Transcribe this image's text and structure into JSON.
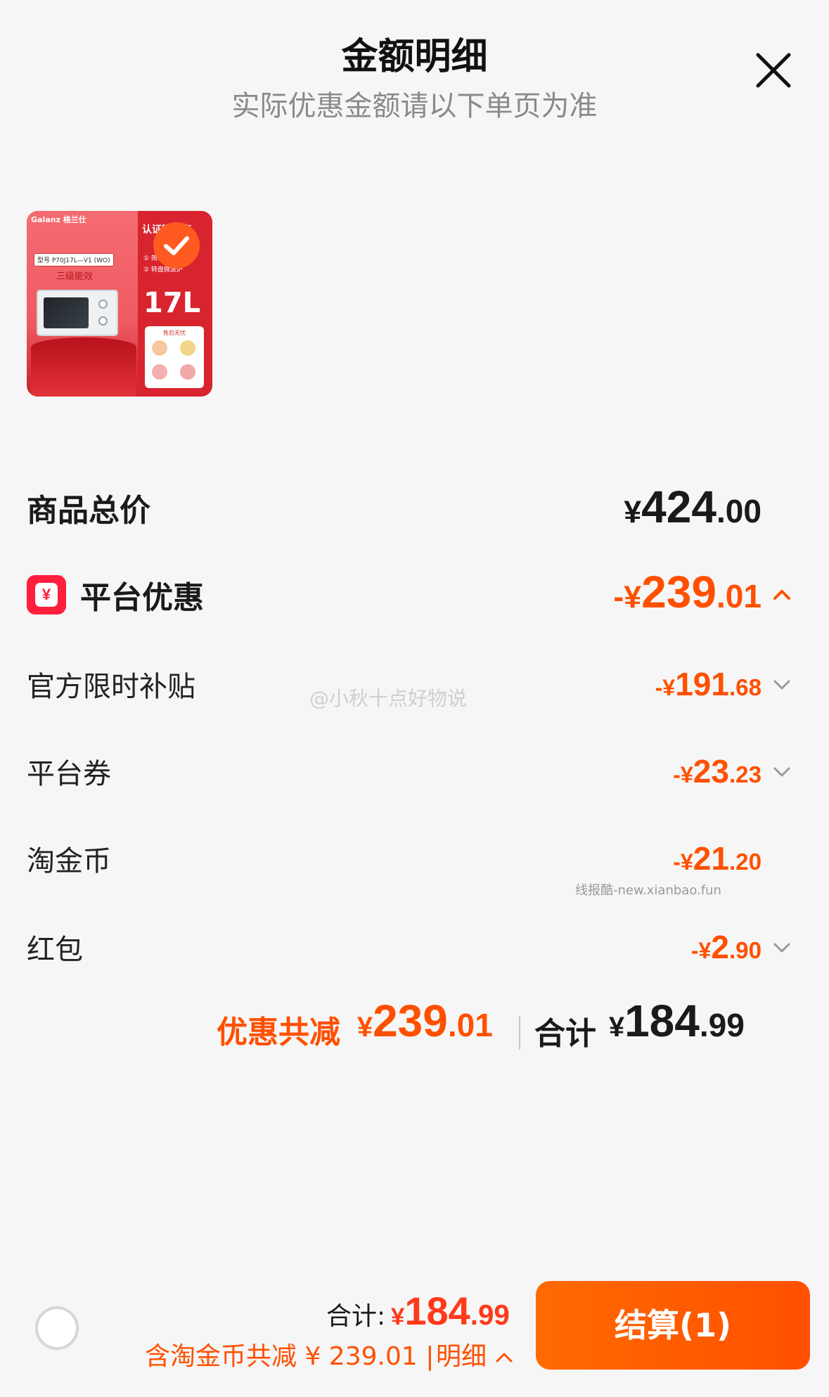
{
  "header": {
    "title": "金额明细",
    "subtitle": "实际优惠金额请以下单页为准",
    "close_icon": "close-icon"
  },
  "product": {
    "brand": "Galanz 格兰仕",
    "model": "型号 P70J17L—V1 (WO)",
    "energy": "三级能效",
    "certified": "认证旗舰店",
    "features": [
      "① 简单易用",
      "② 转盘微波炉"
    ],
    "capacity": "17L",
    "after_sales": "售后无忧",
    "selected": true
  },
  "price_rows": {
    "total": {
      "label": "商品总价",
      "sign": "¥",
      "integer": "424",
      "decimal": ".00"
    },
    "platform": {
      "label": "平台优惠",
      "sign": "-¥",
      "integer": "239",
      "decimal": ".01",
      "icon": "coupon-icon",
      "expanded": true
    },
    "items": [
      {
        "label": "官方限时补贴",
        "sign": "-¥",
        "integer": "191",
        "decimal": ".68",
        "chevron": true
      },
      {
        "label": "平台券",
        "sign": "-¥",
        "integer": "23",
        "decimal": ".23",
        "chevron": true
      },
      {
        "label": "淘金币",
        "sign": "-¥",
        "integer": "21",
        "decimal": ".20",
        "chevron": false
      },
      {
        "label": "红包",
        "sign": "-¥",
        "integer": "2",
        "decimal": ".90",
        "chevron": true
      }
    ]
  },
  "summary": {
    "saving_label": "优惠共减",
    "saving_sign": "¥",
    "saving_integer": "239",
    "saving_decimal": ".01",
    "total_label": "合计",
    "total_sign": "¥",
    "total_integer": "184",
    "total_decimal": ".99"
  },
  "watermarks": {
    "weibo": "@小秋十点好物说",
    "xianbao": "线报酷-new.xianbao.fun"
  },
  "footer": {
    "total_label": "合计:",
    "total_sign": "¥",
    "total_integer": "184",
    "total_decimal": ".99",
    "savings_text": "含淘金币共减 ¥ 239.01 |",
    "detail_link": "明细",
    "checkout_label": "结算(1)"
  },
  "colors": {
    "accent": "#ff5000",
    "price_red": "#ff3a1a",
    "coupon_red": "#ff1f3d",
    "text": "#1a1a1a",
    "muted": "#8a8a8a",
    "background": "#f6f6f6"
  }
}
